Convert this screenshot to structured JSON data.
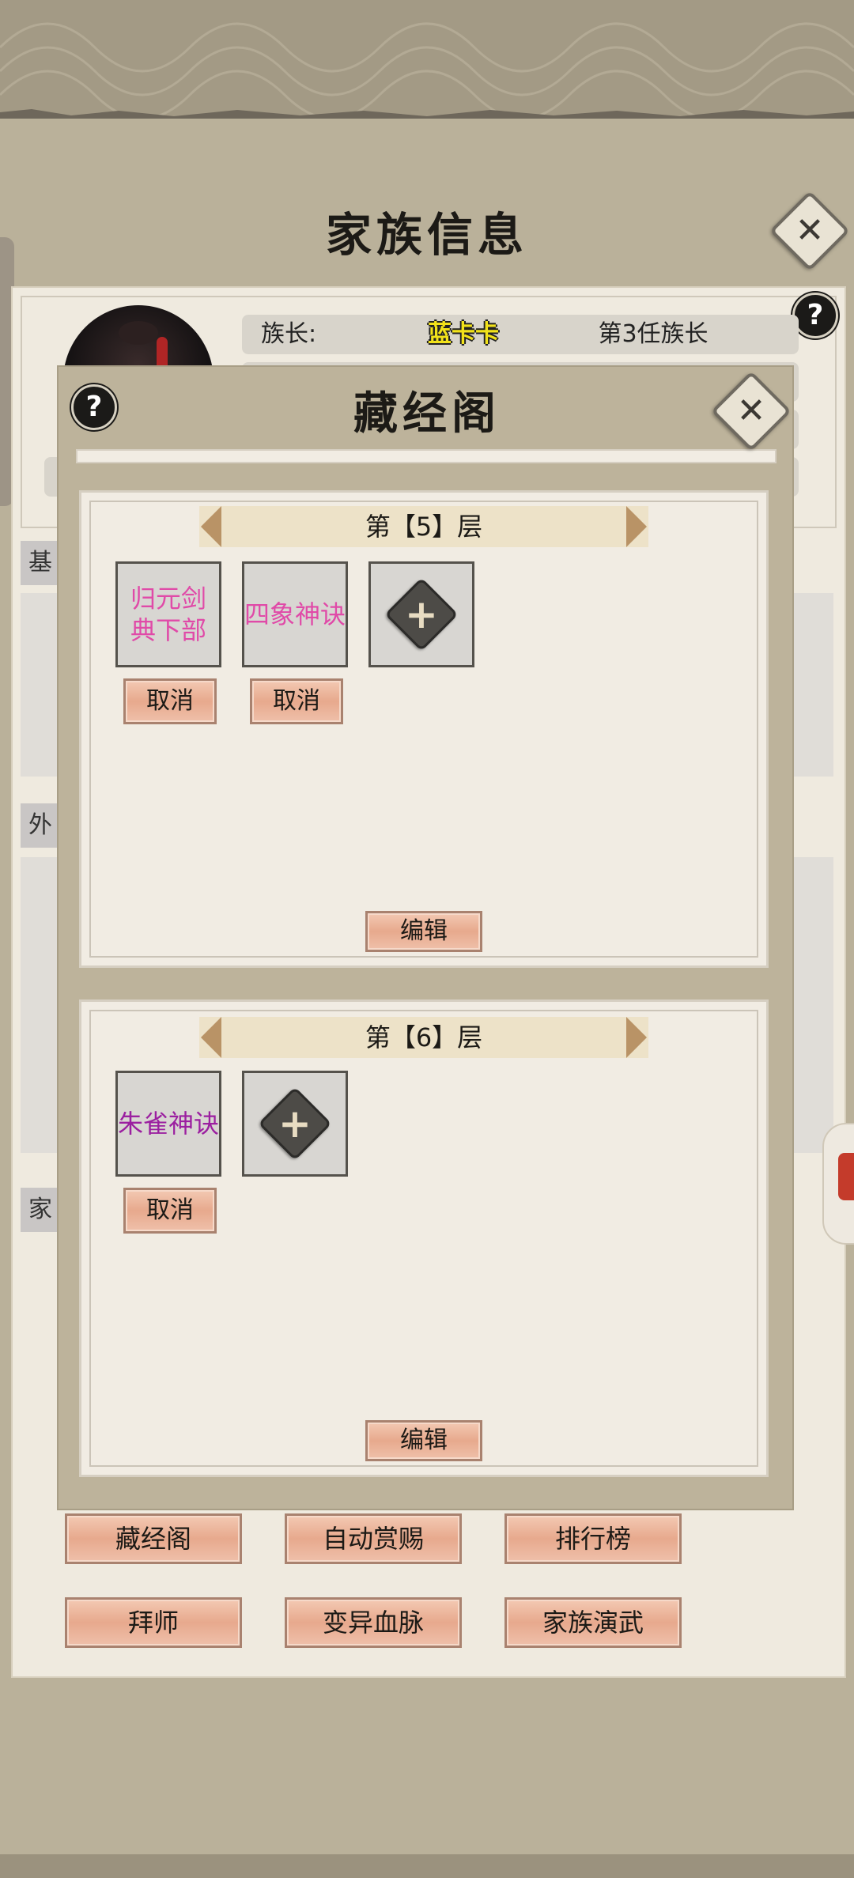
{
  "page_title": "家族信息",
  "leader": {
    "label": "族长:",
    "name": "蓝卡卡",
    "generation": "第3任族长"
  },
  "side_tabs": [
    "基",
    "外",
    "家"
  ],
  "overlay": {
    "title": "藏经阁",
    "floors": [
      {
        "label": "第【5】层",
        "slots": [
          {
            "name": "归元剑典下部",
            "color": "#e04aa8",
            "cancel_label": "取消"
          },
          {
            "name": "四象神诀",
            "color": "#e04aa8",
            "cancel_label": "取消"
          }
        ],
        "edit_label": "编辑"
      },
      {
        "label": "第【6】层",
        "slots": [
          {
            "name": "朱雀神诀",
            "color": "#9b1fa0",
            "cancel_label": "取消"
          }
        ],
        "edit_label": "编辑"
      }
    ]
  },
  "bottom_buttons": [
    [
      "藏经阁",
      "自动赏赐",
      "排行榜"
    ],
    [
      "拜师",
      "变异血脉",
      "家族演武"
    ]
  ],
  "icons": {
    "close": "close-icon",
    "help": "help-icon",
    "add": "plus-icon",
    "arrow_left": "chevron-left-icon",
    "arrow_right": "chevron-right-icon"
  },
  "colors": {
    "leader_name": "#f2e21a",
    "button_peach": "#e7a98d",
    "banner": "#ede2c8"
  }
}
